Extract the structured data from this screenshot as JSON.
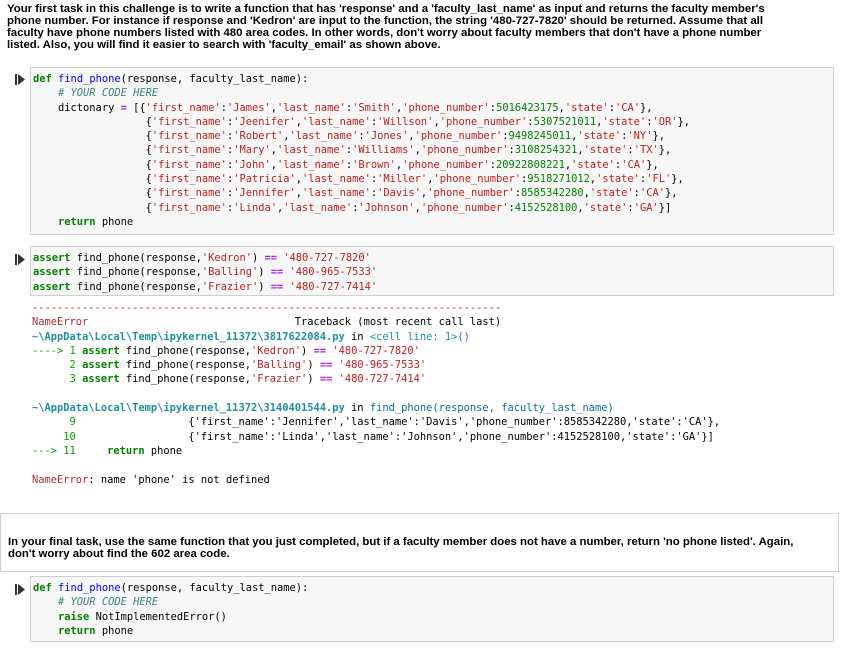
{
  "intro_text": "Your first task in this challenge is to write a function that has 'response' and a 'faculty_last_name' as input and returns the faculty member's phone number. For instance if response and 'Kedron' are input to the function, the string '480-727-7820' should be returned. Assume that all faculty have phone numbers listed with 480 area codes. In other words, don't worry about faculty members that don't have a phone number listed. Also, you will find it easier to search with 'faculty_email' as shown above.",
  "cell1": {
    "def_kw": "def",
    "func_name": "find_phone",
    "params": "(response, faculty_last_name):",
    "comment": "# YOUR CODE HERE",
    "var_name": "dictonary",
    "records": [
      {
        "first": "'James'",
        "last": "'Smith'",
        "phone": "5016423175",
        "state": "'CA'"
      },
      {
        "first": "'Jeenifer'",
        "last": "'Willson'",
        "phone": "5307521011",
        "state": "'OR'"
      },
      {
        "first": "'Robert'",
        "last": "'Jones'",
        "phone": "9498245011",
        "state": "'NY'"
      },
      {
        "first": "'Mary'",
        "last": "'Williams'",
        "phone": "3108254321",
        "state": "'TX'"
      },
      {
        "first": "'John'",
        "last": "'Brown'",
        "phone": "20922808221",
        "state": "'CA'"
      },
      {
        "first": "'Patricia'",
        "last": "'Miller'",
        "phone": "9518271012",
        "state": "'FL'"
      },
      {
        "first": "'Jennifer'",
        "last": "'Davis'",
        "phone": "8585342280",
        "state": "'CA'"
      },
      {
        "first": "'Linda'",
        "last": "'Johnson'",
        "phone": "4152528100",
        "state": "'GA'"
      }
    ],
    "return_kw": "return",
    "return_val": "phone"
  },
  "cell2": {
    "asserts": [
      {
        "name": "'Kedron'",
        "phone": "'480-727-7820'"
      },
      {
        "name": "'Balling'",
        "phone": "'480-965-7533'"
      },
      {
        "name": "'Frazier'",
        "phone": "'480-727-7414'"
      }
    ]
  },
  "error_output": {
    "dashes": "---------------------------------------------------------------------------",
    "error_name": "NameError",
    "traceback_label": "Traceback (most recent call last)",
    "path1": "~\\AppData\\Local\\Temp\\ipykernel_11372\\3817622084.py",
    "in_word": "in",
    "cell_line": "<cell line: 1>",
    "paren": "()",
    "path2": "~\\AppData\\Local\\Temp\\ipykernel_11372\\3140401544.py",
    "func_sig": "find_phone(response, faculty_last_name)",
    "line9": "{'first_name':'Jennifer','last_name':'Davis','phone_number':8585342280,'state':'CA'},",
    "line10": "{'first_name':'Linda','last_name':'Johnson','phone_number':4152528100,'state':'GA'}]",
    "line11": "return phone",
    "final_msg": "name 'phone' is not defined"
  },
  "final_task_text": "In your final task, use the same function that you just completed, but if a faculty member does not have a number, return 'no phone listed'. Again, don't worry about find the 602 area code.",
  "cell3": {
    "def_line_params": "(response, faculty_last_name):",
    "comment": "# YOUR CODE HERE",
    "raise_kw": "raise",
    "raise_val": "NotImplementedError()",
    "return_kw": "return",
    "return_val": "phone"
  }
}
